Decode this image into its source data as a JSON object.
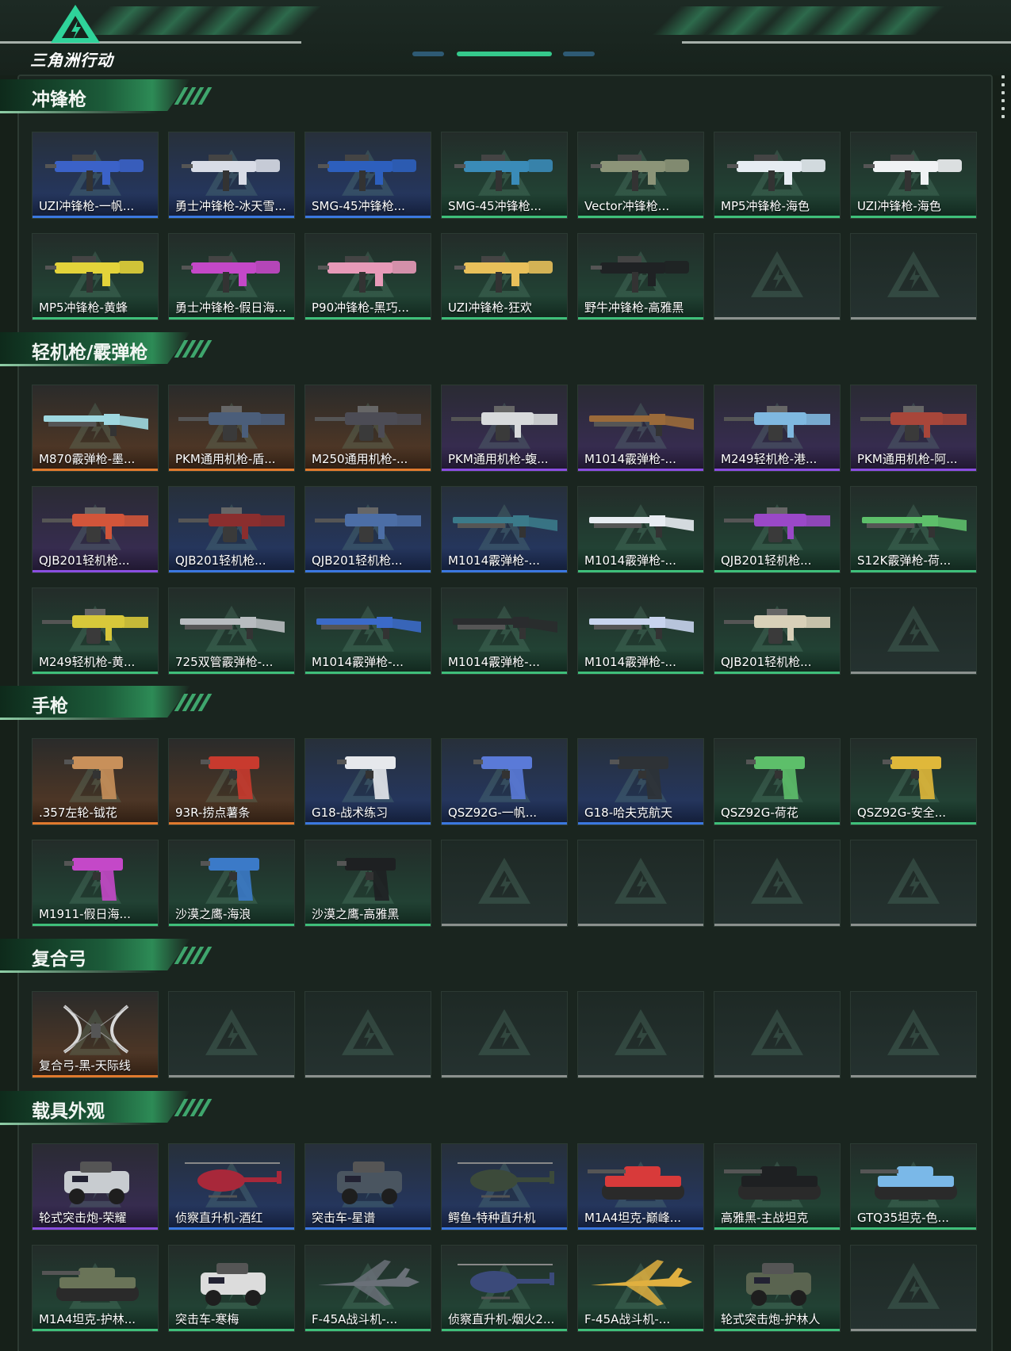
{
  "app": {
    "logo_text": "三角洲行动"
  },
  "colors": {
    "gold": "#e07a2e",
    "purple": "#8a4ee0",
    "blue": "#3b78e0",
    "green": "#3fbf7a",
    "empty": "#8b918e",
    "accent": "#3fa66d",
    "background": "#162019"
  },
  "sections": [
    {
      "title": "冲锋枪",
      "items": [
        {
          "label": "UZI冲锋枪-一帆...",
          "rarity": "blue",
          "icon": "smg-icon",
          "tint": "#3b62c8"
        },
        {
          "label": "勇士冲锋枪-冰天雪...",
          "rarity": "blue",
          "icon": "smg-icon",
          "tint": "#d8dce6"
        },
        {
          "label": "SMG-45冲锋枪...",
          "rarity": "blue",
          "icon": "smg-icon",
          "tint": "#2d5fbd"
        },
        {
          "label": "SMG-45冲锋枪...",
          "rarity": "green",
          "icon": "smg-icon",
          "tint": "#3a8bb8"
        },
        {
          "label": "Vector冲锋枪...",
          "rarity": "green",
          "icon": "smg-icon",
          "tint": "#8c9478"
        },
        {
          "label": "MP5冲锋枪-海色",
          "rarity": "green",
          "icon": "smg-icon",
          "tint": "#e6ecf2"
        },
        {
          "label": "UZI冲锋枪-海色",
          "rarity": "green",
          "icon": "smg-icon",
          "tint": "#f0f2f4"
        },
        {
          "label": "MP5冲锋枪-黄蜂",
          "rarity": "green",
          "icon": "smg-icon",
          "tint": "#e3d33a"
        },
        {
          "label": "勇士冲锋枪-假日海...",
          "rarity": "green",
          "icon": "smg-icon",
          "tint": "#c448c8"
        },
        {
          "label": "P90冲锋枪-黑巧...",
          "rarity": "green",
          "icon": "smg-icon",
          "tint": "#e79ab8"
        },
        {
          "label": "UZI冲锋枪-狂欢",
          "rarity": "green",
          "icon": "smg-icon",
          "tint": "#e8c05a"
        },
        {
          "label": "野牛冲锋枪-高雅黑",
          "rarity": "green",
          "icon": "smg-icon",
          "tint": "#1f2224"
        },
        {
          "label": "",
          "rarity": "empty",
          "icon": "",
          "tint": ""
        },
        {
          "label": "",
          "rarity": "empty",
          "icon": "",
          "tint": ""
        }
      ]
    },
    {
      "title": "轻机枪/霰弹枪",
      "items": [
        {
          "label": "M870霰弹枪-墨...",
          "rarity": "gold",
          "icon": "shotgun-icon",
          "tint": "#9fd8e0"
        },
        {
          "label": "PKM通用机枪-盾...",
          "rarity": "gold",
          "icon": "lmg-icon",
          "tint": "#4b5e7a"
        },
        {
          "label": "M250通用机枪-...",
          "rarity": "gold",
          "icon": "lmg-icon",
          "tint": "#4c4c55"
        },
        {
          "label": "PKM通用机枪-蝮...",
          "rarity": "purple",
          "icon": "lmg-icon",
          "tint": "#d8dadc"
        },
        {
          "label": "M1014霰弹枪-...",
          "rarity": "purple",
          "icon": "shotgun-icon",
          "tint": "#9a6a3a"
        },
        {
          "label": "M249轻机枪-港...",
          "rarity": "purple",
          "icon": "lmg-icon",
          "tint": "#7fb8e0"
        },
        {
          "label": "PKM通用机枪-阿...",
          "rarity": "purple",
          "icon": "lmg-icon",
          "tint": "#a8463a"
        },
        {
          "label": "QJB201轻机枪...",
          "rarity": "purple",
          "icon": "lmg-icon",
          "tint": "#d2553a"
        },
        {
          "label": "QJB201轻机枪...",
          "rarity": "blue",
          "icon": "lmg-icon",
          "tint": "#8a2e2e"
        },
        {
          "label": "QJB201轻机枪...",
          "rarity": "blue",
          "icon": "lmg-icon",
          "tint": "#4c6ea6"
        },
        {
          "label": "M1014霰弹枪-...",
          "rarity": "blue",
          "icon": "shotgun-icon",
          "tint": "#3b7a8a"
        },
        {
          "label": "M1014霰弹枪-...",
          "rarity": "green",
          "icon": "shotgun-icon",
          "tint": "#e8ecf2"
        },
        {
          "label": "QJB201轻机枪...",
          "rarity": "green",
          "icon": "lmg-icon",
          "tint": "#9a48c8"
        },
        {
          "label": "S12K霰弹枪-荷...",
          "rarity": "green",
          "icon": "shotgun-icon",
          "tint": "#5dbf6a"
        },
        {
          "label": "M249轻机枪-黄...",
          "rarity": "green",
          "icon": "lmg-icon",
          "tint": "#d8c83a"
        },
        {
          "label": "725双管霰弹枪-...",
          "rarity": "green",
          "icon": "shotgun-icon",
          "tint": "#b8bcc0"
        },
        {
          "label": "M1014霰弹枪-...",
          "rarity": "green",
          "icon": "shotgun-icon",
          "tint": "#3b6ac8"
        },
        {
          "label": "M1014霰弹枪-...",
          "rarity": "green",
          "icon": "shotgun-icon",
          "tint": "#2a2c2e"
        },
        {
          "label": "M1014霰弹枪-...",
          "rarity": "green",
          "icon": "shotgun-icon",
          "tint": "#c8d4ee"
        },
        {
          "label": "QJB201轻机枪...",
          "rarity": "green",
          "icon": "lmg-icon",
          "tint": "#d8d0b8"
        },
        {
          "label": "",
          "rarity": "empty",
          "icon": "",
          "tint": ""
        }
      ]
    },
    {
      "title": "手枪",
      "items": [
        {
          "label": ".357左轮-钺花",
          "rarity": "gold",
          "icon": "pistol-icon",
          "tint": "#c8905a"
        },
        {
          "label": "93R-捞点薯条",
          "rarity": "gold",
          "icon": "pistol-icon",
          "tint": "#c83a2e"
        },
        {
          "label": "G18-战术练习",
          "rarity": "blue",
          "icon": "pistol-icon",
          "tint": "#e6e8ec"
        },
        {
          "label": "QSZ92G-一帆...",
          "rarity": "blue",
          "icon": "pistol-icon",
          "tint": "#5a7ad8"
        },
        {
          "label": "G18-哈夫克航天",
          "rarity": "blue",
          "icon": "pistol-icon",
          "tint": "#2e3236"
        },
        {
          "label": "QSZ92G-荷花",
          "rarity": "green",
          "icon": "pistol-icon",
          "tint": "#5dbf6a"
        },
        {
          "label": "QSZ92G-安全...",
          "rarity": "green",
          "icon": "pistol-icon",
          "tint": "#e0b83a"
        },
        {
          "label": "M1911-假日海...",
          "rarity": "green",
          "icon": "pistol-icon",
          "tint": "#c448c8"
        },
        {
          "label": "沙漠之鹰-海浪",
          "rarity": "green",
          "icon": "pistol-icon",
          "tint": "#3b7ac8"
        },
        {
          "label": "沙漠之鹰-高雅黑",
          "rarity": "green",
          "icon": "pistol-icon",
          "tint": "#1e2022"
        },
        {
          "label": "",
          "rarity": "empty",
          "icon": "",
          "tint": ""
        },
        {
          "label": "",
          "rarity": "empty",
          "icon": "",
          "tint": ""
        },
        {
          "label": "",
          "rarity": "empty",
          "icon": "",
          "tint": ""
        },
        {
          "label": "",
          "rarity": "empty",
          "icon": "",
          "tint": ""
        }
      ]
    },
    {
      "title": "复合弓",
      "items": [
        {
          "label": "复合弓-黑-天际线",
          "rarity": "gold",
          "icon": "bow-icon",
          "tint": "#d8d8d8"
        },
        {
          "label": "",
          "rarity": "empty",
          "icon": "",
          "tint": ""
        },
        {
          "label": "",
          "rarity": "empty",
          "icon": "",
          "tint": ""
        },
        {
          "label": "",
          "rarity": "empty",
          "icon": "",
          "tint": ""
        },
        {
          "label": "",
          "rarity": "empty",
          "icon": "",
          "tint": ""
        },
        {
          "label": "",
          "rarity": "empty",
          "icon": "",
          "tint": ""
        },
        {
          "label": "",
          "rarity": "empty",
          "icon": "",
          "tint": ""
        }
      ]
    },
    {
      "title": "载具外观",
      "items": [
        {
          "label": "轮式突击炮-荣耀",
          "rarity": "purple",
          "icon": "armored-car-icon",
          "tint": "#c8ccd0"
        },
        {
          "label": "侦察直升机-酒红",
          "rarity": "blue",
          "icon": "helicopter-icon",
          "tint": "#a8283a"
        },
        {
          "label": "突击车-星谱",
          "rarity": "blue",
          "icon": "armored-car-icon",
          "tint": "#4a5560"
        },
        {
          "label": "鳄鱼-特种直升机",
          "rarity": "blue",
          "icon": "helicopter-icon",
          "tint": "#3c4a3a"
        },
        {
          "label": "M1A4坦克-巅峰...",
          "rarity": "blue",
          "icon": "tank-icon",
          "tint": "#d83a3a"
        },
        {
          "label": "高雅黑-主战坦克",
          "rarity": "green",
          "icon": "tank-icon",
          "tint": "#1e2022"
        },
        {
          "label": "GTQ35坦克-色...",
          "rarity": "green",
          "icon": "tank-icon",
          "tint": "#7ab8e8"
        },
        {
          "label": "M1A4坦克-护林...",
          "rarity": "green",
          "icon": "tank-icon",
          "tint": "#6a7458"
        },
        {
          "label": "突击车-寒梅",
          "rarity": "green",
          "icon": "armored-car-icon",
          "tint": "#dcdcdc"
        },
        {
          "label": "F-45A战斗机-...",
          "rarity": "green",
          "icon": "jet-icon",
          "tint": "#6a7078"
        },
        {
          "label": "侦察直升机-烟火2...",
          "rarity": "green",
          "icon": "helicopter-icon",
          "tint": "#3b4a7a"
        },
        {
          "label": "F-45A战斗机-...",
          "rarity": "green",
          "icon": "jet-icon",
          "tint": "#e0b040"
        },
        {
          "label": "轮式突击炮-护林人",
          "rarity": "green",
          "icon": "armored-car-icon",
          "tint": "#5a6450"
        },
        {
          "label": "",
          "rarity": "empty",
          "icon": "",
          "tint": ""
        }
      ]
    }
  ]
}
